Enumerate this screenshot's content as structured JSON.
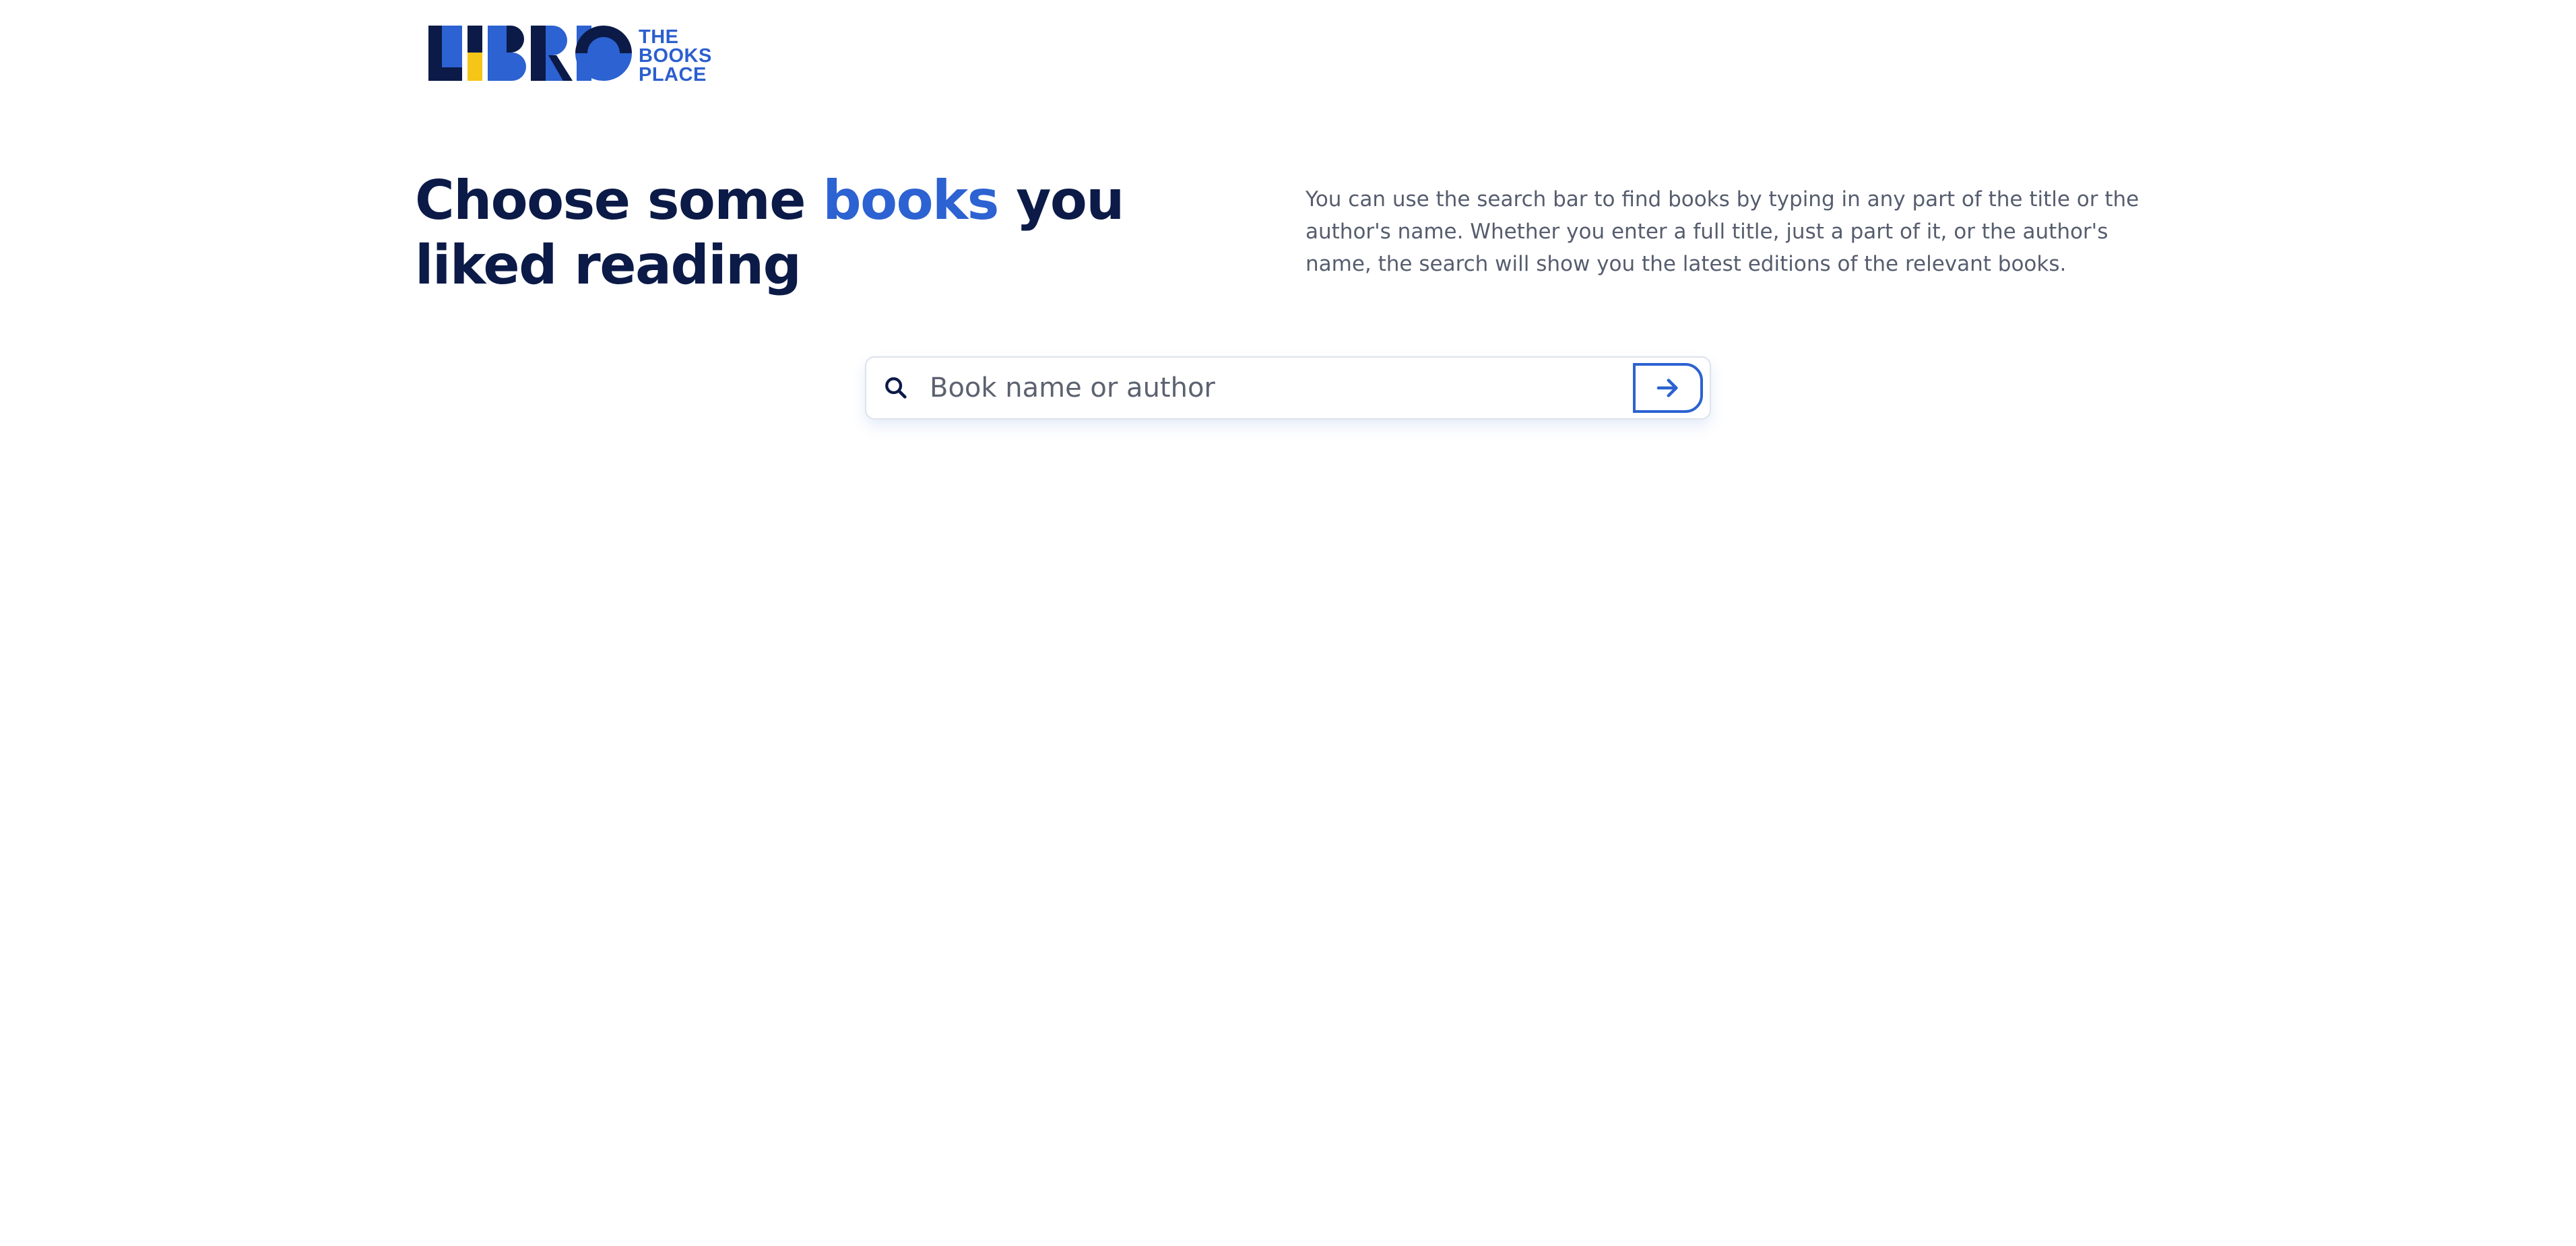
{
  "brand": {
    "logo_text": "LIBRIO",
    "tagline_lines": [
      "THE",
      "BOOKS",
      "PLACE"
    ],
    "colors": {
      "navy": "#0b1a47",
      "blue": "#2c62d1",
      "yellow": "#f5c518"
    }
  },
  "hero": {
    "heading_before": "Choose some ",
    "heading_accent": "books",
    "heading_after": " you liked reading",
    "description": "You can use the search bar to find books by typing in any part of the title or the author's name. Whether you enter a full title, just a part of it, or the author's name, the search will show you the latest editions of the relevant books."
  },
  "search": {
    "value": "",
    "placeholder": "Book name or author",
    "icon": "search-icon",
    "submit_icon": "arrow-right-icon"
  },
  "colors": {
    "text_primary": "#0b1a47",
    "accent": "#2c62d1",
    "text_secondary": "#555d6e",
    "border": "#dde2ec"
  }
}
